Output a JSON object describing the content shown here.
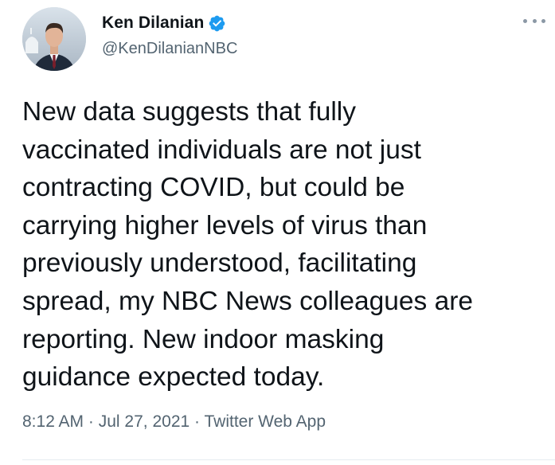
{
  "author": {
    "display_name": "Ken Dilanian",
    "handle": "@KenDilanianNBC",
    "verified": true,
    "avatar_icon": "profile-photo"
  },
  "tweet": {
    "text": "New data suggests that fully\nvaccinated individuals are not just\ncontracting COVID, but could be\ncarrying higher levels of virus than\npreviously understood, facilitating\nspread, my NBC News colleagues are\nreporting.  New indoor masking\nguidance expected today.",
    "time": "8:12 AM",
    "separator": "·",
    "date": "Jul 27, 2021",
    "source": "Twitter Web App"
  },
  "colors": {
    "verified_badge": "#1d9bf0",
    "secondary_text": "#536471",
    "primary_text": "#0f1419"
  },
  "icons": {
    "verified": "verified-badge-icon",
    "more": "more-options-icon"
  }
}
